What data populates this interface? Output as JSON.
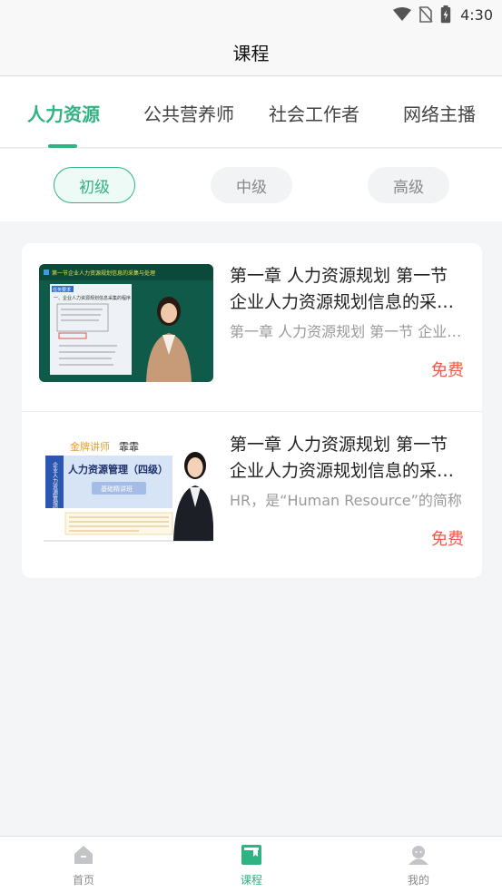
{
  "status_bar": {
    "time": "4:30",
    "icons": [
      "wifi-icon",
      "no-sim-icon",
      "battery-charging-icon"
    ]
  },
  "header": {
    "title": "课程"
  },
  "tabs": [
    {
      "label": "人力资源",
      "active": true
    },
    {
      "label": "公共营养师",
      "active": false
    },
    {
      "label": "社会工作者",
      "active": false
    },
    {
      "label": "网络主播",
      "active": false
    }
  ],
  "levels": [
    {
      "label": "初级",
      "active": true
    },
    {
      "label": "中级",
      "active": false
    },
    {
      "label": "高级",
      "active": false
    }
  ],
  "courses": [
    {
      "title": "第一章 人力资源规划 第一节 企业人力资源规划信息的采集与处理",
      "description": "第一章 人力资源规划 第一节 企业人力资源规划信息的采集与处理",
      "price": "免费",
      "thumbnail": {
        "type": "lecture-video",
        "heading": "第一节企业人力资源规划信息的采集与处理",
        "tag": "任务要求",
        "subheading": "一、企业人力资源规划信息采集的程序"
      }
    },
    {
      "title": "第一章 人力资源规划 第一节 企业人力资源规划信息的采集与处理",
      "description": "HR，是“Human Resource”的简称",
      "price": "免费",
      "thumbnail": {
        "type": "course-cover",
        "teacher_label": "金牌讲师",
        "teacher_name": "霏霏",
        "vertical_label": "企业人力资源管理师",
        "course_name": "人力资源管理（四级）",
        "badge": "基础精讲班"
      }
    }
  ],
  "bottom_nav": [
    {
      "label": "首页",
      "icon": "home-icon",
      "active": false
    },
    {
      "label": "课程",
      "icon": "book-icon",
      "active": true
    },
    {
      "label": "我的",
      "icon": "profile-icon",
      "active": false
    }
  ],
  "colors": {
    "accent": "#2fb383",
    "price": "#f05a4a",
    "background": "#f4f5f7"
  }
}
